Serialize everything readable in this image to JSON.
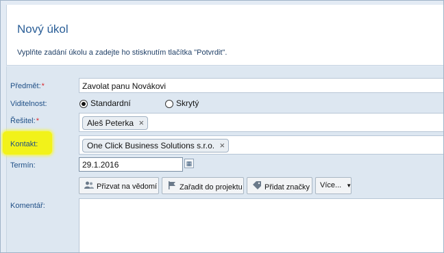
{
  "header": {
    "title": "Nový úkol",
    "subtitle": "Vyplňte zadání úkolu a zadejte ho stisknutím tlačítka \"Potvrdit\"."
  },
  "form": {
    "subject": {
      "label": "Předmět:",
      "required": "*",
      "value": "Zavolat panu Novákovi"
    },
    "visibility": {
      "label": "Viditelnost:",
      "options": [
        {
          "label": "Standardní",
          "selected": true
        },
        {
          "label": "Skrytý",
          "selected": false
        }
      ]
    },
    "assignee": {
      "label": "Řešitel:",
      "required": "*",
      "token": "Aleš Peterka"
    },
    "contact": {
      "label": "Kontakt:",
      "token": "One Click Business Solutions s.r.o."
    },
    "due": {
      "label": "Termín:",
      "value": "29.1.2016"
    },
    "actions": [
      {
        "label": "Přizvat na vědomí",
        "icon": "users-icon"
      },
      {
        "label": "Zařadit do projektu",
        "icon": "flag-icon"
      },
      {
        "label": "Přidat značky",
        "icon": "tag-icon"
      },
      {
        "label": "Více...",
        "icon": "caret-down-icon"
      }
    ],
    "comment": {
      "label": "Komentář:",
      "value": ""
    }
  },
  "remove_glyph": "×",
  "colors": {
    "label": "#1f4f86",
    "title": "#2a5e97",
    "highlight": "#f2f21a",
    "required": "#d9262b"
  }
}
